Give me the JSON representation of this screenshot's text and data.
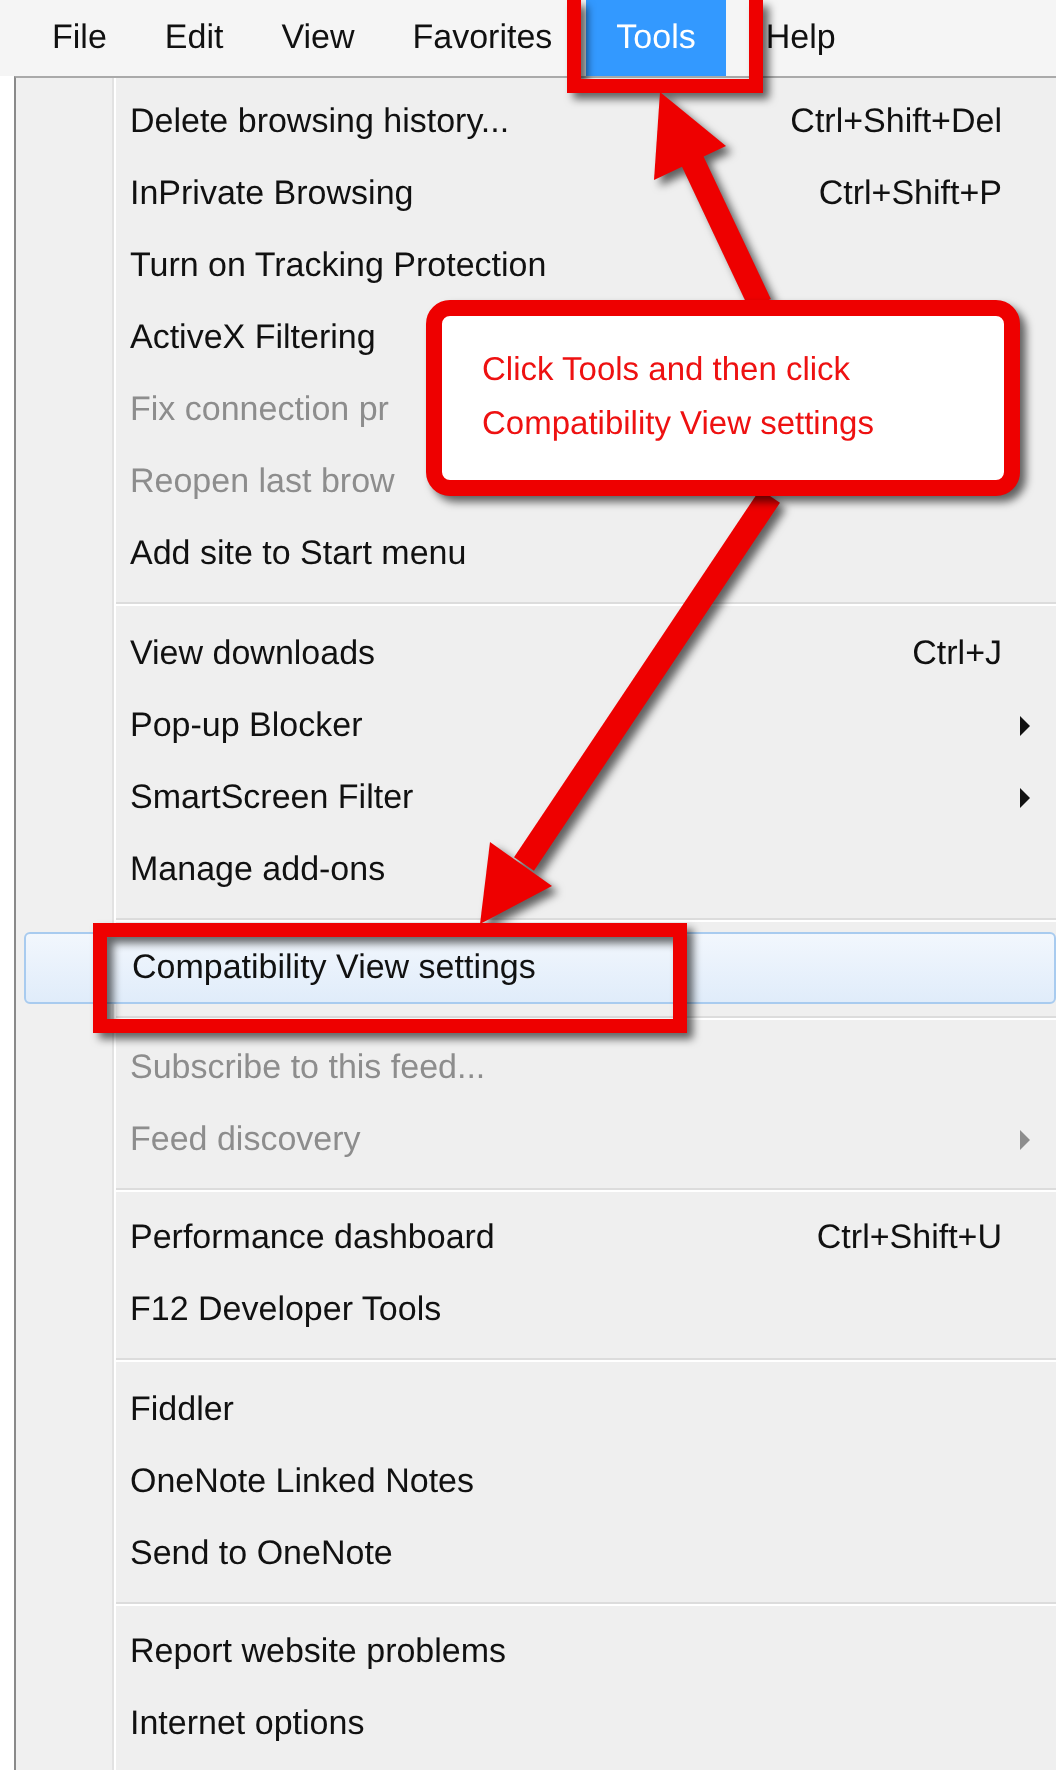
{
  "menu_bar": [
    {
      "label": "File",
      "selected": false
    },
    {
      "label": "Edit",
      "selected": false
    },
    {
      "label": "View",
      "selected": false
    },
    {
      "label": "Favorites",
      "selected": false
    },
    {
      "label": "Tools",
      "selected": true
    },
    {
      "label": "Help",
      "selected": false
    }
  ],
  "menu": {
    "groups": [
      [
        {
          "label": "Delete browsing history...",
          "shortcut": "Ctrl+Shift+Del",
          "disabled": false,
          "submenu": false,
          "selected": false
        },
        {
          "label": "InPrivate Browsing",
          "shortcut": "Ctrl+Shift+P",
          "disabled": false,
          "submenu": false,
          "selected": false
        },
        {
          "label": "Turn on Tracking Protection",
          "disabled": false,
          "submenu": false,
          "selected": false
        },
        {
          "label": "ActiveX Filtering",
          "disabled": false,
          "submenu": false,
          "selected": false
        },
        {
          "label": "Fix connection pr",
          "disabled": true,
          "submenu": false,
          "selected": false
        },
        {
          "label": "Reopen last brow",
          "disabled": true,
          "submenu": false,
          "selected": false
        },
        {
          "label": "Add site to Start menu",
          "disabled": false,
          "submenu": false,
          "selected": false
        }
      ],
      [
        {
          "label": "View downloads",
          "shortcut": "Ctrl+J",
          "disabled": false,
          "submenu": false,
          "selected": false
        },
        {
          "label": "Pop-up Blocker",
          "disabled": false,
          "submenu": true,
          "selected": false
        },
        {
          "label": "SmartScreen Filter",
          "disabled": false,
          "submenu": true,
          "selected": false
        },
        {
          "label": "Manage add-ons",
          "disabled": false,
          "submenu": false,
          "selected": false
        }
      ],
      [
        {
          "label": "Compatibility View settings",
          "disabled": false,
          "submenu": false,
          "selected": true
        }
      ],
      [
        {
          "label": "Subscribe to this feed...",
          "disabled": true,
          "submenu": false,
          "selected": false
        },
        {
          "label": "Feed discovery",
          "disabled": true,
          "submenu": true,
          "selected": false
        }
      ],
      [
        {
          "label": "Performance dashboard",
          "shortcut": "Ctrl+Shift+U",
          "disabled": false,
          "submenu": false,
          "selected": false
        },
        {
          "label": "F12 Developer Tools",
          "disabled": false,
          "submenu": false,
          "selected": false
        }
      ],
      [
        {
          "label": "Fiddler",
          "disabled": false,
          "submenu": false,
          "selected": false
        },
        {
          "label": "OneNote Linked Notes",
          "disabled": false,
          "submenu": false,
          "selected": false
        },
        {
          "label": "Send to OneNote",
          "disabled": false,
          "submenu": false,
          "selected": false
        }
      ],
      [
        {
          "label": "Report website problems",
          "disabled": false,
          "submenu": false,
          "selected": false
        },
        {
          "label": "Internet options",
          "disabled": false,
          "submenu": false,
          "selected": false
        }
      ]
    ]
  },
  "annotation": {
    "callout_lines": [
      "Click Tools and then click",
      "Compatibility View settings"
    ]
  }
}
